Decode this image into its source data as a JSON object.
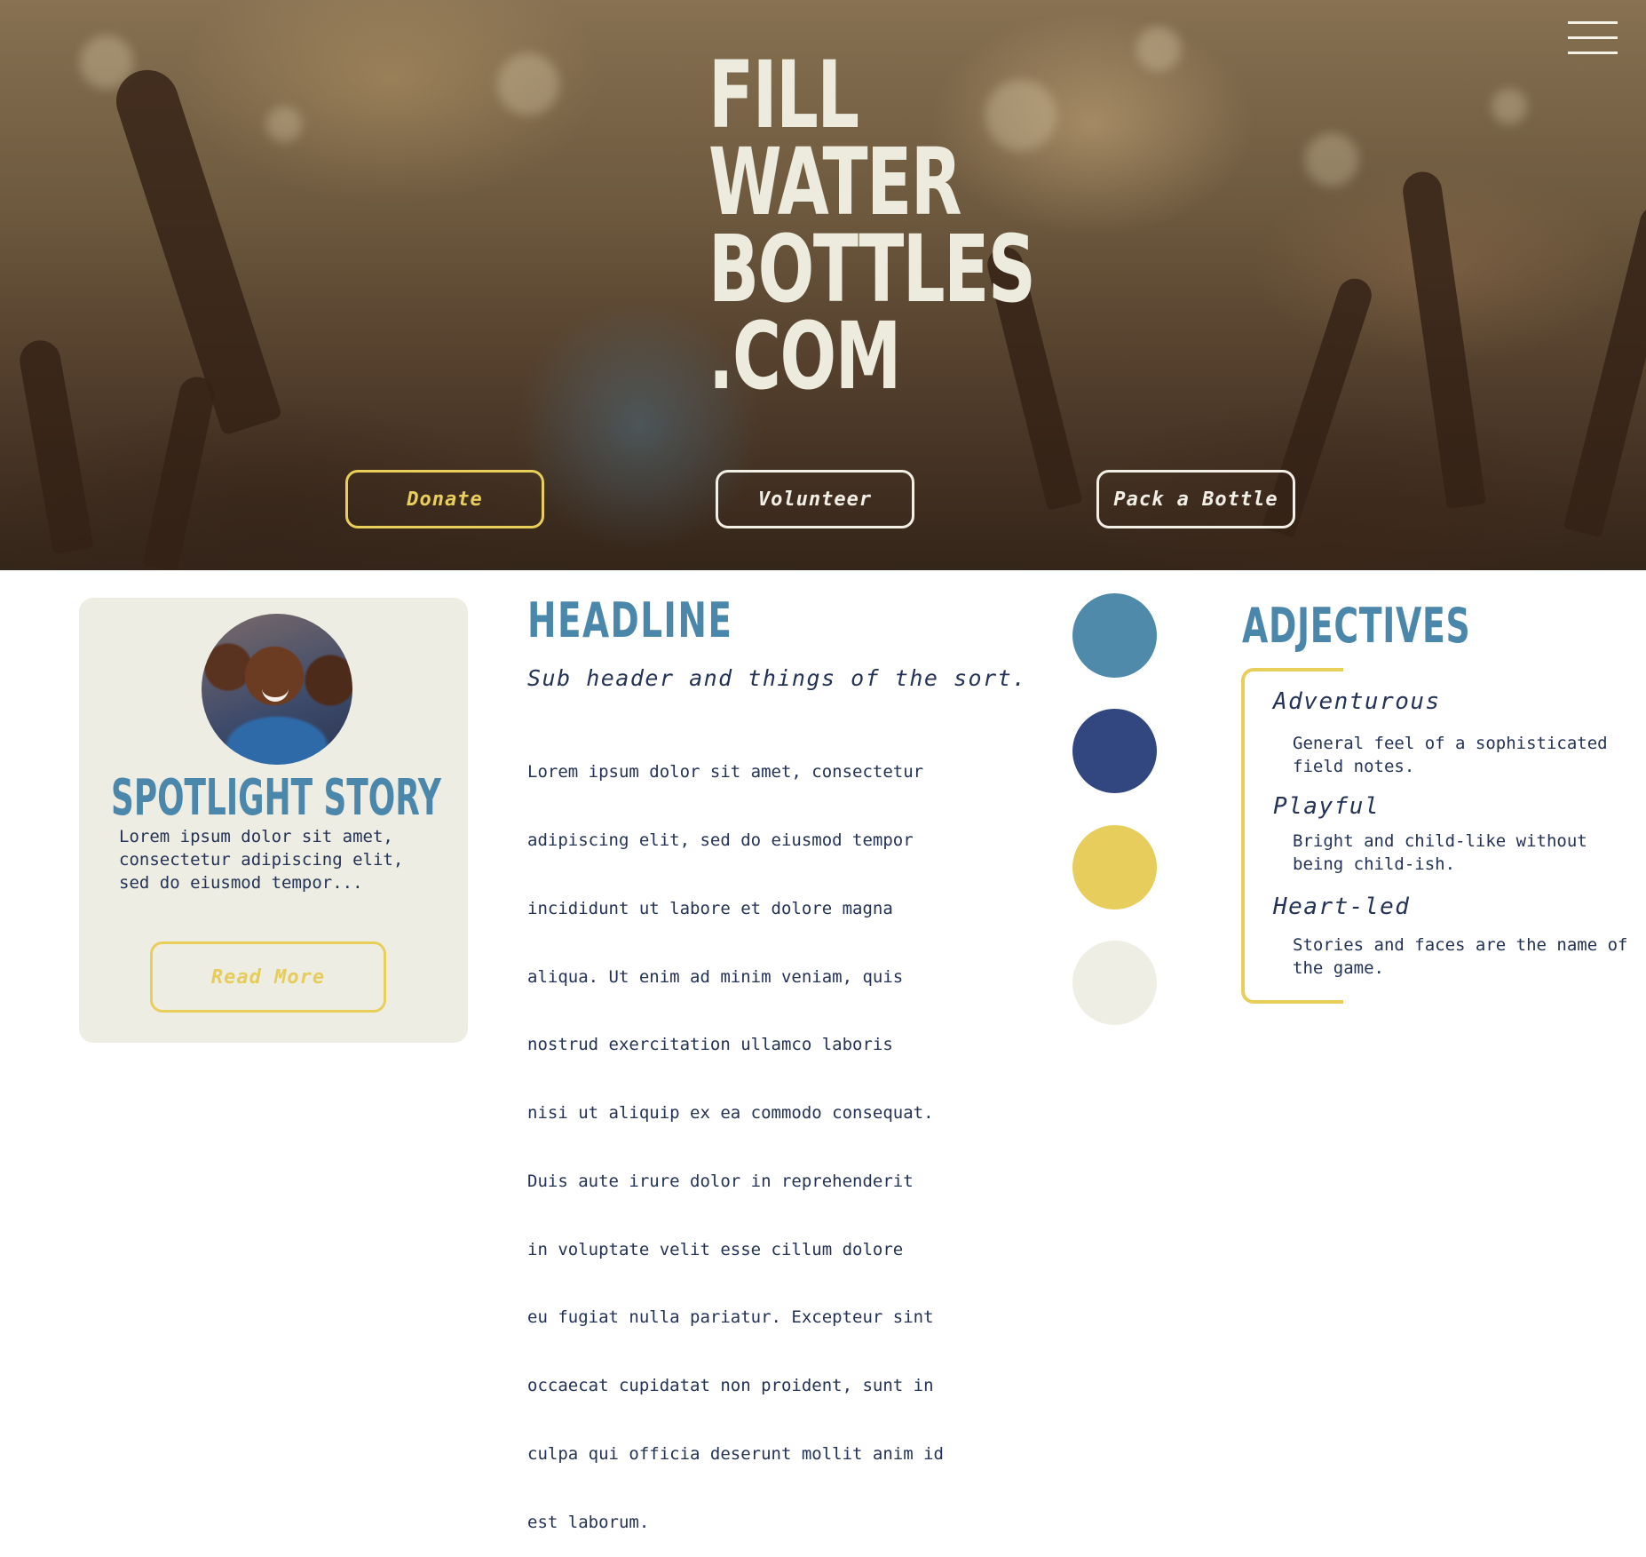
{
  "hero": {
    "title_lines": [
      "FILL",
      "WATER",
      "BOTTLES",
      ".COM"
    ],
    "buttons": {
      "donate": "Donate",
      "volunteer": "Volunteer",
      "pack": "Pack a Bottle"
    },
    "menu_icon": "hamburger-menu-icon"
  },
  "spotlight": {
    "title": "SPOTLIGHT STORY",
    "text": "Lorem ipsum dolor sit amet, consectetur adipiscing elit, sed do eiusmod tempor...",
    "button": "Read More"
  },
  "main": {
    "headline": "HEADLINE",
    "subheader": "Sub header and things of the sort.",
    "body_lines": [
      "Lorem ipsum dolor sit amet, consectetur",
      "adipiscing elit, sed do eiusmod tempor",
      "incididunt ut labore et dolore magna",
      "aliqua. Ut enim ad minim veniam, quis",
      "nostrud exercitation ullamco laboris",
      "nisi ut aliquip ex ea commodo consequat.",
      "Duis aute irure dolor in reprehenderit",
      "in voluptate velit esse cillum dolore",
      "eu fugiat nulla pariatur. Excepteur sint",
      "occaecat cupidatat non proident, sunt in",
      "culpa qui officia deserunt mollit anim id",
      "est laborum."
    ]
  },
  "palette": {
    "colors": [
      "#4f8aab",
      "#32467f",
      "#e7cd5b",
      "#eeeee4"
    ]
  },
  "adjectives": {
    "title": "ADJECTIVES",
    "items": [
      {
        "name": "Adventurous",
        "description": "General feel of a sophisticated field notes."
      },
      {
        "name": "Playful",
        "description": "Bright and child-like without being child-ish."
      },
      {
        "name": "Heart-led",
        "description": "Stories and faces are the name of the game."
      }
    ]
  }
}
